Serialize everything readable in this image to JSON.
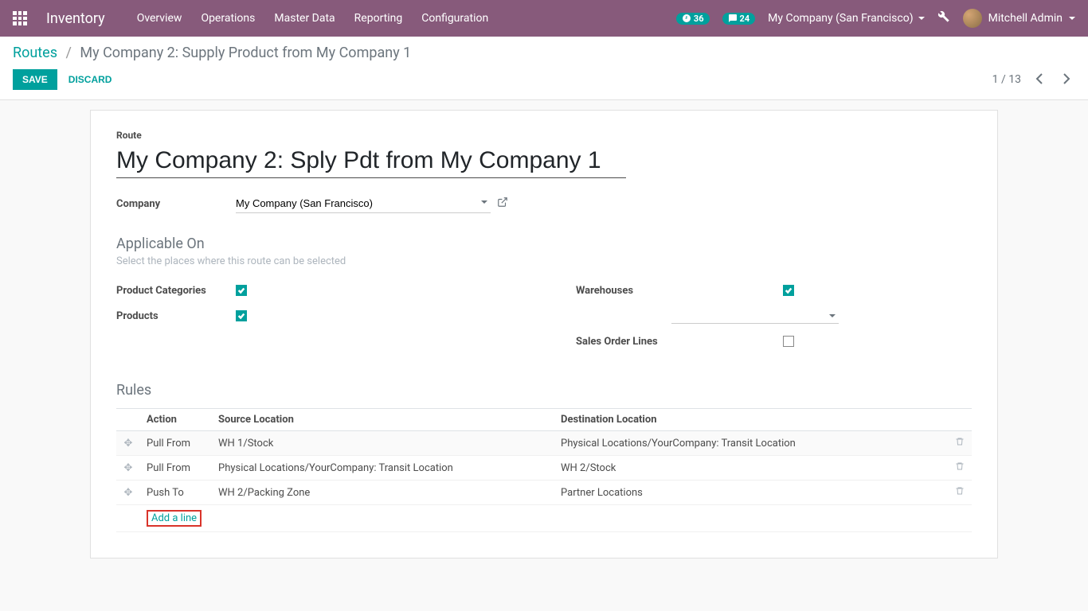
{
  "navbar": {
    "brand": "Inventory",
    "menu": [
      "Overview",
      "Operations",
      "Master Data",
      "Reporting",
      "Configuration"
    ],
    "activity_count": "36",
    "messages_count": "24",
    "company": "My Company (San Francisco)",
    "user": "Mitchell Admin"
  },
  "breadcrumb": {
    "root": "Routes",
    "current": "My Company 2: Supply Product from My Company 1"
  },
  "buttons": {
    "save": "Save",
    "discard": "Discard"
  },
  "pager": {
    "text": "1 / 13"
  },
  "form": {
    "route_label": "Route",
    "route_name": "My Company 2: Sply Pdt from My Company 1",
    "company_label": "Company",
    "company_value": "My Company (San Francisco)",
    "applicable_title": "Applicable On",
    "applicable_hint": "Select the places where this route can be selected",
    "prod_cat_label": "Product Categories",
    "products_label": "Products",
    "warehouses_label": "Warehouses",
    "sol_label": "Sales Order Lines",
    "rules_title": "Rules",
    "rules_cols": {
      "action": "Action",
      "src": "Source Location",
      "dest": "Destination Location"
    },
    "rules": [
      {
        "action": "Pull From",
        "src": "WH 1/Stock",
        "dest": "Physical Locations/YourCompany: Transit Location"
      },
      {
        "action": "Pull From",
        "src": "Physical Locations/YourCompany: Transit Location",
        "dest": "WH 2/Stock"
      },
      {
        "action": "Push To",
        "src": "WH 2/Packing Zone",
        "dest": "Partner Locations"
      }
    ],
    "add_line": "Add a line"
  }
}
